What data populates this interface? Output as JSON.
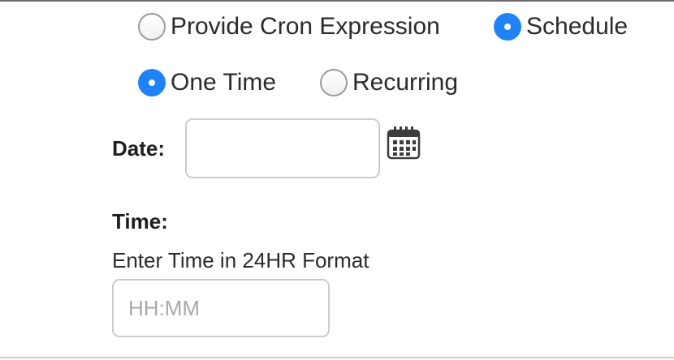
{
  "mode_options": {
    "cron_label": "Provide Cron Expression",
    "schedule_label": "Schedule",
    "selected": "Schedule"
  },
  "frequency_options": {
    "one_time_label": "One Time",
    "recurring_label": "Recurring",
    "selected": "One Time"
  },
  "date_field": {
    "label": "Date:",
    "value": "",
    "placeholder": "",
    "picker_icon": "calendar-icon"
  },
  "time_field": {
    "label": "Time:",
    "hint": "Enter Time in 24HR Format",
    "value": "",
    "placeholder": "HH:MM"
  },
  "colors": {
    "radio_selected": "#1f82f7",
    "radio_unselected_border": "#9a9a9a",
    "input_border": "#cccccc",
    "placeholder_text": "#a9a9a9"
  }
}
